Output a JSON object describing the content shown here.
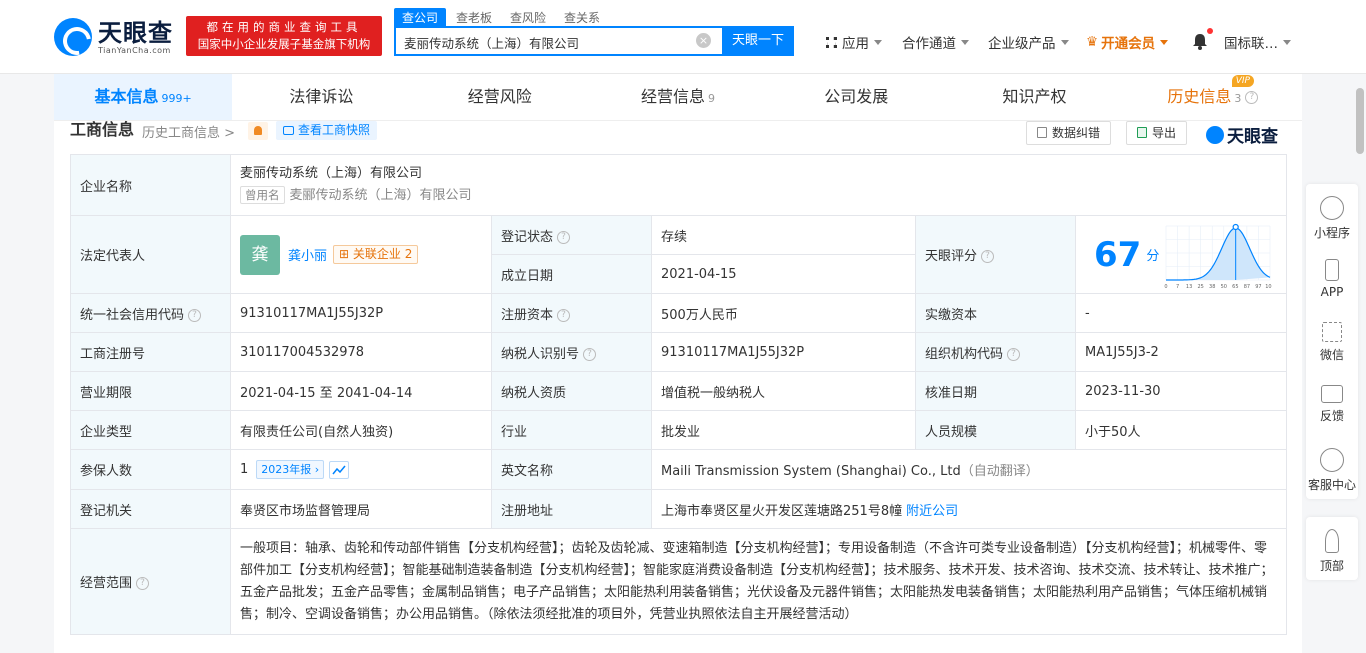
{
  "brand": {
    "name_cn": "天眼查",
    "name_en": "TianYanCha.com",
    "slogan_line1": "都在用的商业查询工具",
    "slogan_line2": "国家中小企业发展子基金旗下机构"
  },
  "search": {
    "tabs": [
      "查公司",
      "查老板",
      "查风险",
      "查关系"
    ],
    "query": "麦丽传动系统（上海）有限公司",
    "button": "天眼一下"
  },
  "topnav": {
    "apps": "应用",
    "channel": "合作通道",
    "enterprise": "企业级产品",
    "vip": "开通会员",
    "intl": "国标联…"
  },
  "tabs": [
    {
      "label": "基本信息",
      "count": "999+"
    },
    {
      "label": "法律诉讼",
      "count": ""
    },
    {
      "label": "经营风险",
      "count": ""
    },
    {
      "label": "经营信息",
      "count": "9"
    },
    {
      "label": "公司发展",
      "count": ""
    },
    {
      "label": "知识产权",
      "count": ""
    },
    {
      "label": "历史信息",
      "count": "3",
      "badge": "VIP"
    }
  ],
  "section": {
    "title": "工商信息",
    "history_link": "历史工商信息 >",
    "snapshot": "查看工商快照",
    "correction": "数据纠错",
    "export": "导出",
    "mark": "天眼查"
  },
  "info": {
    "company_name_label": "企业名称",
    "company_name": "麦丽传动系统（上海）有限公司",
    "former_tag": "曾用名",
    "former_name": "麦郦传动系统（上海）有限公司",
    "legal_rep_label": "法定代表人",
    "legal_rep_avatar": "龚",
    "legal_rep": "龚小丽",
    "related_label": "关联企业",
    "related_count": "2",
    "reg_status_label": "登记状态",
    "reg_status": "存续",
    "found_date_label": "成立日期",
    "found_date": "2021-04-15",
    "score_label": "天眼评分",
    "score": "67",
    "score_unit": "分",
    "credit_code_label": "统一社会信用代码",
    "credit_code": "91310117MA1J55J32P",
    "reg_capital_label": "注册资本",
    "reg_capital": "500万人民币",
    "paid_capital_label": "实缴资本",
    "paid_capital": "-",
    "reg_no_label": "工商注册号",
    "reg_no": "310117004532978",
    "taxpayer_id_label": "纳税人识别号",
    "taxpayer_id": "91310117MA1J55J32P",
    "org_code_label": "组织机构代码",
    "org_code": "MA1J55J3-2",
    "term_label": "营业期限",
    "term": "2021-04-15 至 2041-04-14",
    "taxpayer_qual_label": "纳税人资质",
    "taxpayer_qual": "增值税一般纳税人",
    "approval_date_label": "核准日期",
    "approval_date": "2023-11-30",
    "type_label": "企业类型",
    "type": "有限责任公司(自然人独资)",
    "industry_label": "行业",
    "industry": "批发业",
    "staff_label": "人员规模",
    "staff": "小于50人",
    "insured_label": "参保人数",
    "insured": "1",
    "annual_report": "2023年报",
    "english_name_label": "英文名称",
    "english_name": "Maili Transmission System (Shanghai) Co., Ltd",
    "auto_translate": "（自动翻译）",
    "authority_label": "登记机关",
    "authority": "奉贤区市场监督管理局",
    "address_label": "注册地址",
    "address": "上海市奉贤区星火开发区莲塘路251号8幢",
    "nearby": "附近公司",
    "scope_label": "经营范围",
    "scope": "一般项目：轴承、齿轮和传动部件销售【分支机构经营】；齿轮及齿轮减、变速箱制造【分支机构经营】；专用设备制造（不含许可类专业设备制造）【分支机构经营】；机械零件、零部件加工【分支机构经营】；智能基础制造装备制造【分支机构经营】；智能家庭消费设备制造【分支机构经营】；技术服务、技术开发、技术咨询、技术交流、技术转让、技术推广；五金产品批发；五金产品零售；金属制品销售；电子产品销售；太阳能热利用装备销售；光伏设备及元器件销售；太阳能热发电装备销售；太阳能热利用产品销售；气体压缩机械销售；制冷、空调设备销售；办公用品销售。（除依法须经批准的项目外，凭营业执照依法自主开展经营活动）"
  },
  "score_chart": {
    "x_ticks": [
      "0",
      "7",
      "13",
      "25",
      "38",
      "50",
      "65",
      "87",
      "97",
      "100"
    ],
    "marker_score": 67
  },
  "sidebar": [
    "小程序",
    "APP",
    "微信",
    "反馈",
    "客服中心",
    "顶部"
  ],
  "colors": {
    "accent": "#0084ff",
    "vip": "#e6730b",
    "status": "#1ea86b"
  }
}
